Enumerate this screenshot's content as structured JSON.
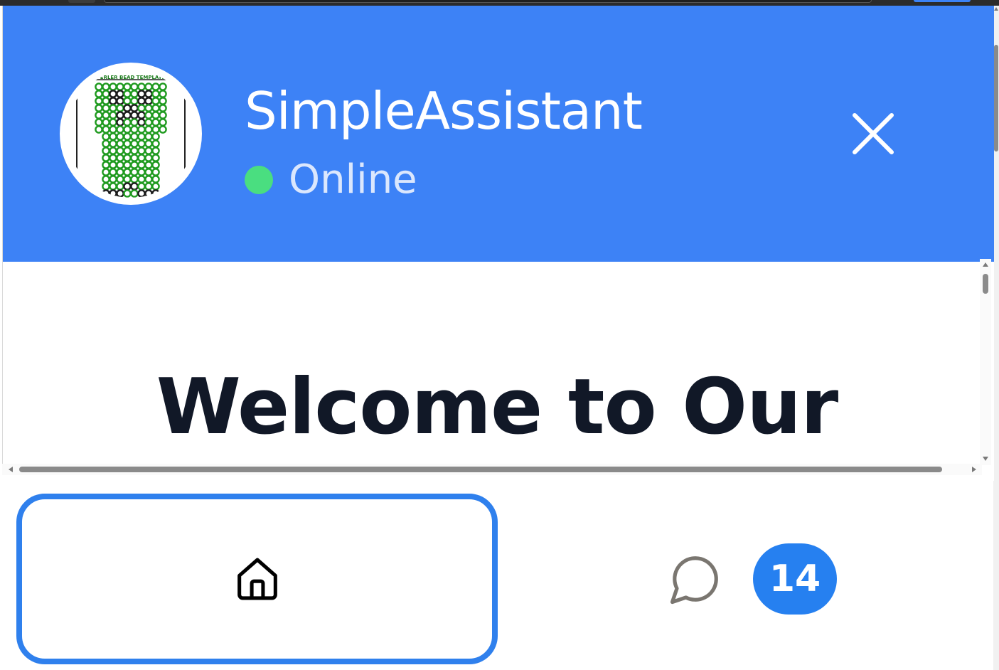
{
  "header": {
    "assistant_name": "SimpleAssistant",
    "status_text": "Online",
    "status_color": "#4ade80",
    "background_color": "#3d82f6",
    "avatar_icon": "perler-bead-creeper-avatar",
    "avatar_caption": "PERLER BEAD TEMPLATE",
    "close_icon": "close-icon"
  },
  "content": {
    "welcome_heading": "Welcome to Our"
  },
  "bottom_nav": {
    "home_icon": "home-icon",
    "messages_icon": "chat-bubble-icon",
    "messages_badge": "14",
    "accent_color": "#2f80ed"
  }
}
